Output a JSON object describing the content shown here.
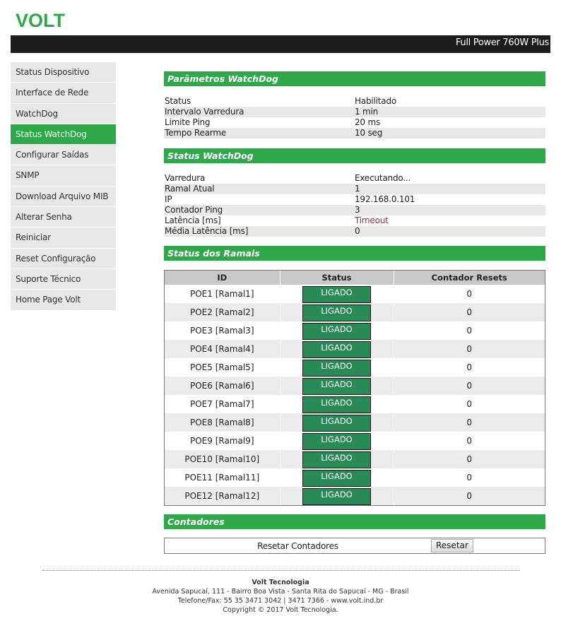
{
  "header": {
    "logo_text": "VOLT",
    "device_title": "Full Power 760W Plus",
    "brand_color": "#2fa84a"
  },
  "sidebar": {
    "items": [
      {
        "label": "Status Dispositivo",
        "active": false
      },
      {
        "label": "Interface de Rede",
        "active": false
      },
      {
        "label": "WatchDog",
        "active": false
      },
      {
        "label": "Status WatchDog",
        "active": true
      },
      {
        "label": "Configurar Saídas",
        "active": false
      },
      {
        "label": "SNMP",
        "active": false
      },
      {
        "label": "Download Arquivo MIB",
        "active": false
      },
      {
        "label": "Alterar Senha",
        "active": false
      },
      {
        "label": "Reiniciar",
        "active": false
      },
      {
        "label": "Reset Configuração",
        "active": false
      },
      {
        "label": "Suporte Técnico",
        "active": false
      },
      {
        "label": "Home Page Volt",
        "active": false
      }
    ]
  },
  "parametros": {
    "title": "Parâmetros WatchDog",
    "rows": [
      {
        "label": "Status",
        "value": "Habilitado"
      },
      {
        "label": "Intervalo Varredura",
        "value": "1 min"
      },
      {
        "label": "Limite Ping",
        "value": "20 ms"
      },
      {
        "label": "Tempo Rearme",
        "value": "10 seg"
      }
    ]
  },
  "status_watchdog": {
    "title": "Status WatchDog",
    "rows": [
      {
        "label": "Varredura",
        "value": "Executando..."
      },
      {
        "label": "Ramal Atual",
        "value": "1"
      },
      {
        "label": "IP",
        "value": "192.168.0.101"
      },
      {
        "label": "Contador Ping",
        "value": "3"
      },
      {
        "label": "Latência [ms]",
        "value": "Timeout",
        "highlight_color": "#b0283c"
      },
      {
        "label": "Média Latência [ms]",
        "value": "0"
      }
    ]
  },
  "ramais": {
    "title": "Status dos Ramais",
    "columns": [
      "ID",
      "Status",
      "Contador Resets"
    ],
    "rows": [
      {
        "id": "POE1 [Ramal1]",
        "status": "LIGADO",
        "resets": "0"
      },
      {
        "id": "POE2 [Ramal2]",
        "status": "LIGADO",
        "resets": "0"
      },
      {
        "id": "POE3 [Ramal3]",
        "status": "LIGADO",
        "resets": "0"
      },
      {
        "id": "POE4 [Ramal4]",
        "status": "LIGADO",
        "resets": "0"
      },
      {
        "id": "POE5 [Ramal5]",
        "status": "LIGADO",
        "resets": "0"
      },
      {
        "id": "POE6 [Ramal6]",
        "status": "LIGADO",
        "resets": "0"
      },
      {
        "id": "POE7 [Ramal7]",
        "status": "LIGADO",
        "resets": "0"
      },
      {
        "id": "POE8 [Ramal8]",
        "status": "LIGADO",
        "resets": "0"
      },
      {
        "id": "POE9 [Ramal9]",
        "status": "LIGADO",
        "resets": "0"
      },
      {
        "id": "POE10 [Ramal10]",
        "status": "LIGADO",
        "resets": "0"
      },
      {
        "id": "POE11 [Ramal11]",
        "status": "LIGADO",
        "resets": "0"
      },
      {
        "id": "POE12 [Ramal12]",
        "status": "LIGADO",
        "resets": "0"
      }
    ],
    "status_color": "#2a8a55"
  },
  "contadores": {
    "title": "Contadores",
    "label": "Resetar Contadores",
    "button_label": "Resetar"
  },
  "footer": {
    "company": "Volt Tecnologia",
    "address": "Avenida Sapucaí, 111 - Bairro Boa Vista - Santa Rita do Sapucaí - MG - Brasil",
    "phone": "Telefone/Fax: 55 35 3471 3042 | 3471 7366 - www.volt.ind.br",
    "copyright": "Copyright © 2017 Volt Tecnologia."
  }
}
